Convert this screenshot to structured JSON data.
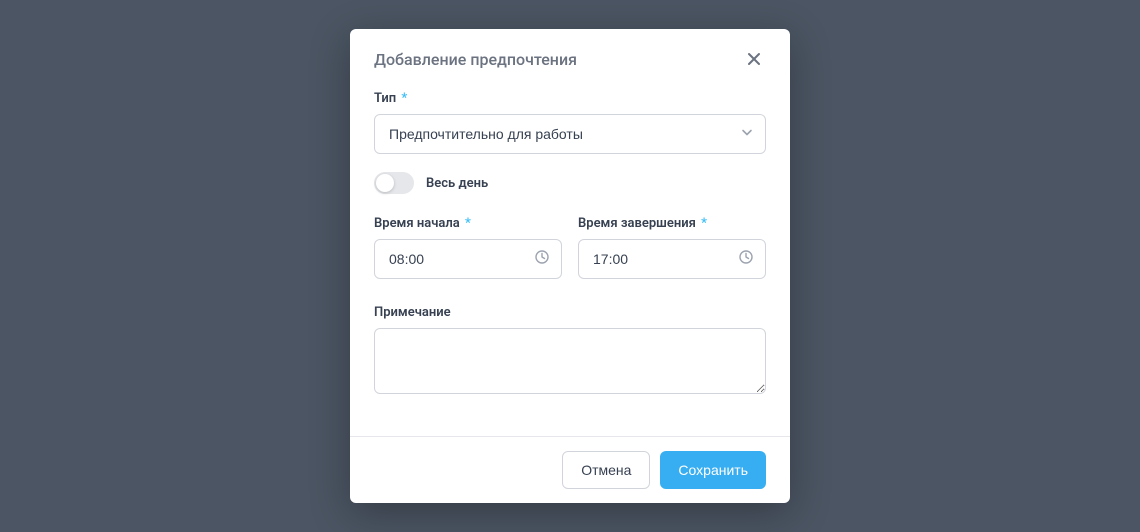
{
  "modal": {
    "title": "Добавление предпочтения",
    "type_label": "Тип",
    "type_value": "Предпочтительно для работы",
    "allday_label": "Весь день",
    "allday_on": false,
    "start_label": "Время начала",
    "start_value": "08:00",
    "end_label": "Время завершения",
    "end_value": "17:00",
    "note_label": "Примечание",
    "note_value": "",
    "cancel_label": "Отмена",
    "save_label": "Сохранить",
    "required_mark": "*"
  }
}
